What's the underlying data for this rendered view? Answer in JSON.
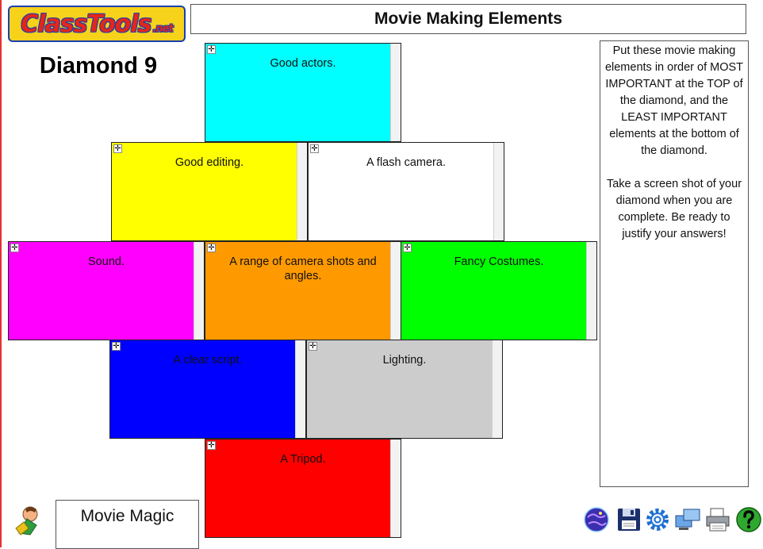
{
  "brand": {
    "logo_main": "ClassTools",
    "logo_suffix": ".net"
  },
  "header": {
    "title": "Movie Making Elements"
  },
  "side": {
    "title": "Diamond 9"
  },
  "instructions": "Put these movie making elements in order of MOST IMPORTANT at the TOP of the diamond, and the LEAST IMPORTANT elements at the bottom of the diamond.\n\nTake a screen shot of your diamond when you are complete.  Be ready to justify your answers!",
  "cards": [
    {
      "label": "Good actors.",
      "color": "#00ffff"
    },
    {
      "label": "Good editing.",
      "color": "#ffff00"
    },
    {
      "label": "A flash camera.",
      "color": "#ffffff"
    },
    {
      "label": "Sound.",
      "color": "#ff00ff"
    },
    {
      "label": "A range of camera shots and angles.",
      "color": "#ff9900"
    },
    {
      "label": "Fancy Costumes.",
      "color": "#00ff00"
    },
    {
      "label": "A clear script.",
      "color": "#0000ff"
    },
    {
      "label": "Lighting.",
      "color": "#cccccc"
    },
    {
      "label": "A Tripod.",
      "color": "#ff0000"
    }
  ],
  "footer": {
    "label": "Movie Magic"
  },
  "toolbar": [
    "globe-icon",
    "save-icon",
    "settings-icon",
    "screens-icon",
    "print-icon",
    "help-icon"
  ]
}
